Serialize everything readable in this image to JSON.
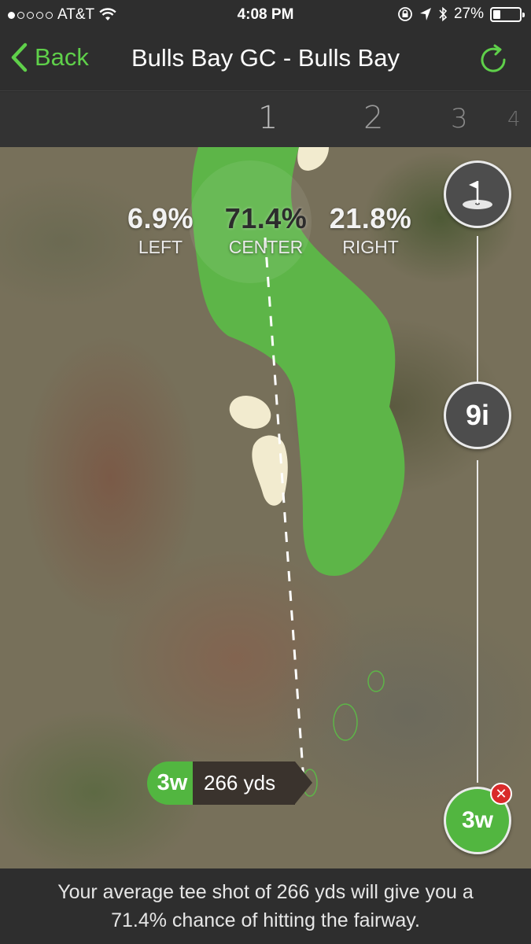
{
  "status_bar": {
    "carrier": "AT&T",
    "time": "4:08 PM",
    "battery": "27%",
    "battery_level": 0.27
  },
  "nav": {
    "back_label": "Back",
    "title": "Bulls Bay GC - Bulls Bay"
  },
  "holes": [
    "1",
    "2",
    "3",
    "4"
  ],
  "stats": {
    "left": {
      "value": "6.9%",
      "label": "LEFT"
    },
    "center": {
      "value": "71.4%",
      "label": "CENTER"
    },
    "right": {
      "value": "21.8%",
      "label": "RIGHT"
    }
  },
  "clubs": {
    "approach": "9i",
    "tee": "3w"
  },
  "shot": {
    "club": "3w",
    "distance": "266 yds"
  },
  "footer": {
    "message": "Your average tee shot of 266 yds will give you a 71.4% chance of hitting the fairway."
  },
  "colors": {
    "accent_green": "#5fd04a",
    "fairway_green": "#5db548",
    "remove_red": "#d92a2a"
  }
}
